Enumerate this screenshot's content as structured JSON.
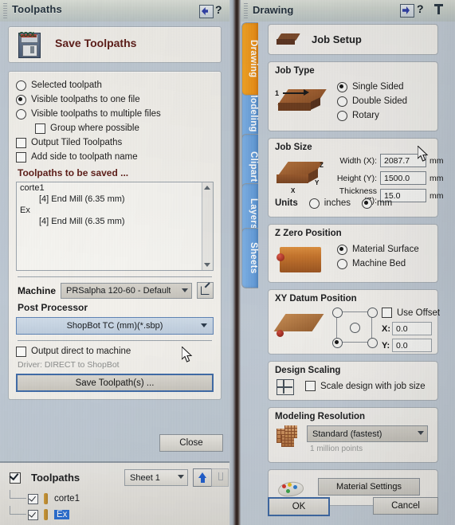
{
  "left_panel": {
    "titlebar": {
      "title": "Toolpaths",
      "collapse_icon": "auto-hide-arrow-icon",
      "help_icon": "?"
    },
    "header": {
      "icon": "save-disk-icon",
      "icon_text": "COOL",
      "title": "Save Toolpaths"
    },
    "output_options": [
      {
        "type": "radio",
        "label": "Selected toolpath",
        "checked": false,
        "indent": false
      },
      {
        "type": "radio",
        "label": "Visible toolpaths to one file",
        "checked": true,
        "indent": false
      },
      {
        "type": "radio",
        "label": "Visible toolpaths to multiple files",
        "checked": false,
        "indent": false
      },
      {
        "type": "checkbox",
        "label": "Group where possible",
        "checked": false,
        "indent": true
      },
      {
        "type": "checkbox",
        "label": "Output Tiled Toolpaths",
        "checked": false,
        "indent": false
      },
      {
        "type": "checkbox",
        "label": "Add side to toolpath name",
        "checked": false,
        "indent": false
      }
    ],
    "toolpaths_to_be_saved": {
      "title": "Toolpaths to be saved ...",
      "items": [
        {
          "name": "corte1",
          "sub": false
        },
        {
          "name": "[4] End Mill (6.35 mm)",
          "sub": true
        },
        {
          "name": "Ex",
          "sub": false
        },
        {
          "name": "[4] End Mill (6.35 mm)",
          "sub": true
        }
      ]
    },
    "machine": {
      "label": "Machine",
      "value": "PRSalpha 120-60 - Default",
      "edit_icon": "edit-pencil-icon"
    },
    "post_processor": {
      "label": "Post Processor",
      "value": "ShopBot TC (mm)(*.sbp)"
    },
    "output_direct": {
      "label": "Output direct to machine",
      "checked": false,
      "driver_text": "Driver: DIRECT to ShopBot"
    },
    "save_button": "Save Toolpath(s) ...",
    "close_button": "Close",
    "toolpaths_tree": {
      "header_label": "Toolpaths",
      "header_checked": true,
      "sheet_value": "Sheet 1",
      "move_up_icon": "arrow-up-icon",
      "move_down_icon": "arrow-down-icon",
      "rows": [
        {
          "label": "corte1",
          "checked": true,
          "selected": false
        },
        {
          "label": "Ex",
          "checked": true,
          "selected": true
        }
      ]
    }
  },
  "right_panel": {
    "titlebar": {
      "title": "Drawing",
      "collapse_icon": "auto-hide-arrow-icon",
      "help_icon": "?",
      "pin_icon": "pin-icon"
    },
    "vertical_tabs": [
      {
        "label": "Drawing",
        "active": true
      },
      {
        "label": "Modeling",
        "active": false
      },
      {
        "label": "Clipart",
        "active": false
      },
      {
        "label": "Layers",
        "active": false
      },
      {
        "label": "Sheets",
        "active": false
      }
    ],
    "job_setup": {
      "title": "Job Setup",
      "icon": "job-block-icon"
    },
    "job_type": {
      "title": "Job Type",
      "icon": "single-sided-block-icon",
      "icon_label": "1",
      "options": [
        {
          "label": "Single Sided",
          "checked": true
        },
        {
          "label": "Double Sided",
          "checked": false
        },
        {
          "label": "Rotary",
          "checked": false
        }
      ]
    },
    "job_size": {
      "title": "Job Size",
      "icon": "material-block-xyz-icon",
      "axis_labels": {
        "x": "X",
        "y": "Y",
        "z": "Z"
      },
      "fields": [
        {
          "label": "Width (X):",
          "value": "2087.7",
          "unit": "mm"
        },
        {
          "label": "Height (Y):",
          "value": "1500.0",
          "unit": "mm"
        },
        {
          "label": "Thickness (Z):",
          "value": "15.0",
          "unit": "mm"
        }
      ],
      "units_label": "Units",
      "units_options": [
        {
          "label": "inches",
          "checked": false
        },
        {
          "label": "mm",
          "checked": true
        }
      ]
    },
    "z_zero": {
      "title": "Z Zero Position",
      "icon": "z-zero-block-icon",
      "options": [
        {
          "label": "Material Surface",
          "checked": true
        },
        {
          "label": "Machine Bed",
          "checked": false
        }
      ]
    },
    "xy_datum": {
      "title": "XY Datum Position",
      "icon": "xy-datum-plane-icon",
      "use_offset_label": "Use Offset",
      "use_offset_checked": false,
      "x_label": "X:",
      "x_value": "0.0",
      "y_label": "Y:",
      "y_value": "0.0",
      "selected_node": "bottom-left"
    },
    "design_scaling": {
      "title": "Design Scaling",
      "icon": "scale-grid-icon",
      "checkbox_label": "Scale design with job size",
      "checked": false
    },
    "modeling_resolution": {
      "title": "Modeling Resolution",
      "icon": "resolution-grid-icon",
      "value": "Standard (fastest)",
      "note": "1 million points"
    },
    "material_settings": {
      "icon": "palette-icon",
      "button_label": "Material Settings"
    },
    "ok_button": "OK",
    "cancel_button": "Cancel"
  },
  "colors": {
    "accent_blue": "#3f6ba8",
    "tab_active_orange": "#ee8b12",
    "tab_blue": "#5c97d8",
    "header_red": "#5c1b16",
    "selection_blue": "#2a6fd4",
    "panel_bg": "#c2ccd6",
    "card_bg": "#f3f1ec"
  }
}
